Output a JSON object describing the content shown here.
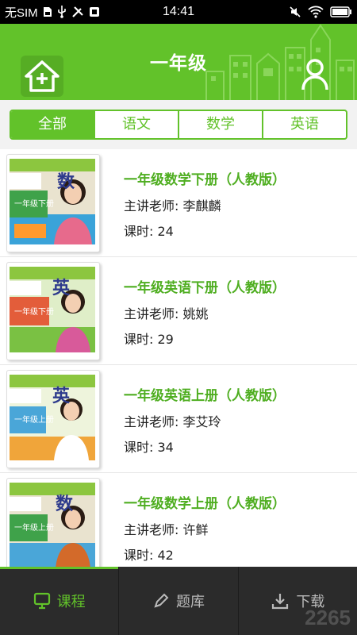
{
  "status_bar": {
    "carrier": "无SIM",
    "time": "14:41",
    "left_icons": [
      "sim-card-icon",
      "usb-icon",
      "tools-icon",
      "app-icon"
    ],
    "right_icons": [
      "mute-icon",
      "wifi-icon",
      "battery-icon"
    ]
  },
  "header": {
    "title": "一年级",
    "home_icon": "home-add-icon",
    "user_icon": "user-icon",
    "accent_color": "#62c22a"
  },
  "tabs": [
    {
      "label": "全部",
      "active": true
    },
    {
      "label": "语文",
      "active": false
    },
    {
      "label": "数学",
      "active": false
    },
    {
      "label": "英语",
      "active": false
    }
  ],
  "courses": [
    {
      "title": "一年级数学下册（人教版）",
      "teacher": "主讲老师: 李麒麟",
      "hours": "课时: 24",
      "book_char": "数",
      "book_label": "一年级下册"
    },
    {
      "title": "一年级英语下册（人教版）",
      "teacher": "主讲老师: 姚姚",
      "hours": "课时: 29",
      "book_char": "英",
      "book_label": "一年级下册"
    },
    {
      "title": "一年级英语上册（人教版）",
      "teacher": "主讲老师: 李艾玲",
      "hours": "课时: 34",
      "book_char": "英",
      "book_label": "一年级上册"
    },
    {
      "title": "一年级数学上册（人教版）",
      "teacher": "主讲老师: 许鲜",
      "hours": "课时: 42",
      "book_char": "数",
      "book_label": "一年级上册"
    }
  ],
  "bottom_nav": [
    {
      "label": "课程",
      "icon": "monitor-icon",
      "active": true
    },
    {
      "label": "题库",
      "icon": "pencil-icon",
      "active": false
    },
    {
      "label": "下载",
      "icon": "download-icon",
      "active": false
    }
  ],
  "watermark": "2265"
}
